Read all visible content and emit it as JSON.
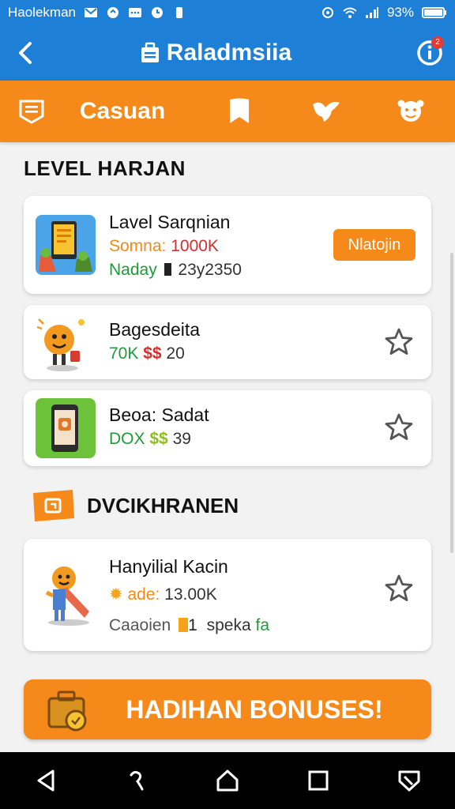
{
  "status_bar": {
    "carrier": "Haolekman",
    "battery": "93%"
  },
  "app_bar": {
    "title": "Raladmsiia",
    "notification_count": "2"
  },
  "tabs": [
    {
      "label": "Casuan",
      "icon": "list-icon"
    },
    {
      "label": "",
      "icon": "bookmark-icon"
    },
    {
      "label": "",
      "icon": "bird-icon"
    },
    {
      "label": "",
      "icon": "mascot-icon"
    }
  ],
  "section1": {
    "title": "LEVEL HARJAN"
  },
  "cards": [
    {
      "title": "Lavel Sarqnian",
      "line1_label": "Somna:",
      "line1_value": "1000K",
      "line2_label": "Naday",
      "line2_value": "23y2350",
      "action": "Nlatojin",
      "thumb_icon": "phone-app-icon"
    },
    {
      "title": "Bagesdeita",
      "line1_label": "70K",
      "line1_value": "$$",
      "line1_extra": "20",
      "thumb_icon": "orange-mascot-icon"
    },
    {
      "title": "Beoa: Sadat",
      "line1_label": "DOX",
      "line1_value": "$$",
      "line1_extra": "39",
      "thumb_icon": "phone-green-icon"
    }
  ],
  "section2": {
    "title": "DVCIKHRANEN"
  },
  "card4": {
    "title": "Hanyilial Kacin",
    "line1_label": "ade:",
    "line1_value": "13.00K",
    "line2_a": "Caaoien",
    "line2_b": "1",
    "line2_c": "speka",
    "line2_d": "fa",
    "thumb_icon": "running-mascot-icon"
  },
  "bonus": {
    "label": "HADIHAN BONUSES!"
  },
  "colors": {
    "blue": "#1e7fd6",
    "orange": "#f5891a",
    "green": "#1e9a3a",
    "red": "#d32f2f"
  }
}
